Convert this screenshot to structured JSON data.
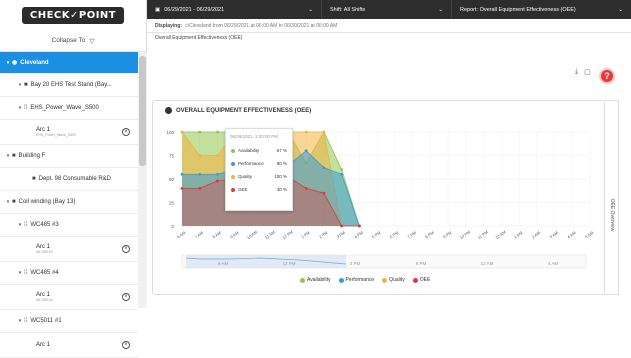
{
  "logo": {
    "text": "CHECK✓POINT"
  },
  "sidebar": {
    "collapse_label": "Collapse To",
    "tree": [
      {
        "label": "Cleveland",
        "level": 0,
        "type": "site",
        "selected": true
      },
      {
        "label": "Bay 20 EHS Test Stand (Bay...",
        "level": 1,
        "type": "folder"
      },
      {
        "label": "EHS_Power_Wave_S500",
        "level": 1,
        "type": "machine"
      },
      {
        "leaf": true,
        "label": "Arc 1",
        "sub": "EHS_Power_Wave_S500"
      },
      {
        "label": "Building F",
        "level": 0,
        "type": "folder"
      },
      {
        "label": "Dept. 98 Consumable R&D",
        "level": 1,
        "type": "folder"
      },
      {
        "label": "Coil winding (Bay 13)",
        "level": 0,
        "type": "folder"
      },
      {
        "label": "WC485 #3",
        "level": 1,
        "type": "machine"
      },
      {
        "leaf": true,
        "label": "Arc 1",
        "sub": "WC485 #3"
      },
      {
        "label": "WC485 #4",
        "level": 1,
        "type": "machine"
      },
      {
        "leaf": true,
        "label": "Arc 1",
        "sub": "WC485 #4"
      },
      {
        "label": "WC5011 #1",
        "level": 1,
        "type": "machine"
      },
      {
        "leaf": true,
        "label": "Arc 1",
        "sub": ""
      }
    ]
  },
  "topbar": {
    "date_range": "06/29/2021 - 06/29/2021",
    "shift_label": "Shift:",
    "shift_value": "All Shifts",
    "report_label": "Report:",
    "report_value": "Overall Equipment Effectiveness (OEE)"
  },
  "info": {
    "displaying_label": "Displaying:",
    "displaying_value": "Cleveland  from 06/29/2021 at 06:00 AM to 06/30/2021 at 06:00 AM"
  },
  "subtitle": "Overall Equipment Effectiveness (OEE)",
  "card_title": "OVERALL EQUIPMENT EFFECTIVENESS (OEE)",
  "rail_label": "OEE Overview",
  "tooltip": {
    "header": "06/29/2021, 1:00:00 PM",
    "rows": [
      {
        "label": "Availability",
        "value": "67 %",
        "color": "#8fc64f"
      },
      {
        "label": "Performance",
        "value": "80 %",
        "color": "#3a9ad9"
      },
      {
        "label": "Quality",
        "value": "100 %",
        "color": "#f4b23f"
      },
      {
        "label": "OEE",
        "value": "40 %",
        "color": "#e0373b"
      }
    ]
  },
  "help_label": "?",
  "chart_data": {
    "type": "area",
    "x": [
      "6 AM",
      "7 AM",
      "8 AM",
      "9 AM",
      "10 AM",
      "11 AM",
      "12 PM",
      "1 PM",
      "2 PM",
      "3 PM",
      "4 PM",
      "5 PM",
      "6 PM",
      "7 PM",
      "8 PM",
      "9 PM",
      "10 PM",
      "11 PM",
      "12 AM",
      "1 AM",
      "2 AM",
      "3 AM",
      "4 AM",
      "5 AM"
    ],
    "ylim": [
      0,
      100
    ],
    "yticks": [
      0,
      25,
      50,
      75,
      100
    ],
    "series": [
      {
        "name": "Availability",
        "color": "#8fc64f",
        "values": [
          100,
          100,
          100,
          100,
          100,
          100,
          100,
          67,
          100,
          60,
          0
        ]
      },
      {
        "name": "Performance",
        "color": "#3a9ad9",
        "values": [
          55,
          55,
          55,
          60,
          62,
          65,
          65,
          80,
          62,
          55,
          0
        ]
      },
      {
        "name": "Quality",
        "color": "#f4b23f",
        "values": [
          100,
          75,
          75,
          100,
          100,
          100,
          100,
          100,
          100,
          0,
          0
        ]
      },
      {
        "name": "OEE",
        "color": "#e0373b",
        "values": [
          40,
          40,
          48,
          50,
          50,
          52,
          52,
          40,
          35,
          0,
          0
        ]
      }
    ],
    "navigator_labels": [
      "8 AM",
      "12 PM",
      "4 PM",
      "8 PM",
      "12 AM",
      "4 AM"
    ]
  }
}
